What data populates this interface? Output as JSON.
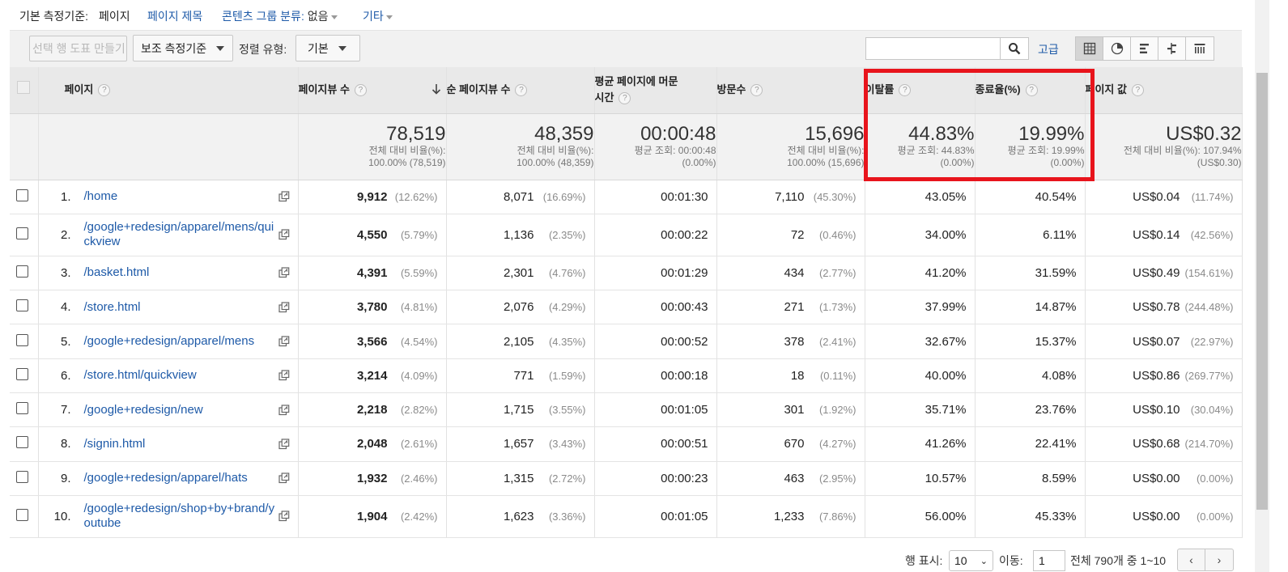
{
  "dimension_bar": {
    "primary_label": "기본 측정기준:",
    "primary_value": "페이지",
    "alt_dimension": "페이지 제목",
    "content_group_label": "콘텐츠 그룹 분류:",
    "content_group_value": "없음",
    "other": "기타"
  },
  "toolbar": {
    "create_chart": "선택 행 도표 만들기",
    "secondary_dimension": "보조 측정기준",
    "sort_type_label": "정렬 유형:",
    "sort_type_value": "기본",
    "search_value": "",
    "advanced": "고급"
  },
  "view_icons": [
    "table-view-icon",
    "pie-view-icon",
    "bar-view-icon",
    "comparison-view-icon",
    "pivot-view-icon"
  ],
  "columns": {
    "page": "페이지",
    "pageviews": "페이지뷰 수",
    "unique_pageviews": "순 페이지뷰 수",
    "avg_time_line1": "평균 페이지에 머문",
    "avg_time_line2": "시간",
    "entrances": "방문수",
    "bounce_rate": "이탈률",
    "exit_rate": "종료율(%)",
    "page_value": "페이지 값"
  },
  "totals": {
    "pageviews": {
      "value": "78,519",
      "sub1": "전체 대비 비율(%):",
      "sub2": "100.00% (78,519)"
    },
    "unique_pageviews": {
      "value": "48,359",
      "sub1": "전체 대비 비율(%):",
      "sub2": "100.00% (48,359)"
    },
    "avg_time": {
      "value": "00:00:48",
      "sub1": "평균 조회: 00:00:48",
      "sub2": "(0.00%)"
    },
    "entrances": {
      "value": "15,696",
      "sub1": "전체 대비 비율(%):",
      "sub2": "100.00% (15,696)"
    },
    "bounce_rate": {
      "value": "44.83%",
      "sub1": "평균 조회: 44.83%",
      "sub2": "(0.00%)"
    },
    "exit_rate": {
      "value": "19.99%",
      "sub1": "평균 조회: 19.99%",
      "sub2": "(0.00%)"
    },
    "page_value": {
      "value": "US$0.32",
      "sub1": "전체 대비 비율(%): 107.94%",
      "sub2": "(US$0.30)"
    }
  },
  "rows": [
    {
      "idx": "1.",
      "page": "/home",
      "pv": "9,912",
      "pv_pct": "(12.62%)",
      "upv": "8,071",
      "upv_pct": "(16.69%)",
      "time": "00:01:30",
      "ent": "7,110",
      "ent_pct": "(45.30%)",
      "bounce": "43.05%",
      "exit": "40.54%",
      "val": "US$0.04",
      "val_pct": "(11.74%)"
    },
    {
      "idx": "2.",
      "page": "/google+redesign/apparel/mens/quickview",
      "pv": "4,550",
      "pv_pct": "(5.79%)",
      "upv": "1,136",
      "upv_pct": "(2.35%)",
      "time": "00:00:22",
      "ent": "72",
      "ent_pct": "(0.46%)",
      "bounce": "34.00%",
      "exit": "6.11%",
      "val": "US$0.14",
      "val_pct": "(42.56%)"
    },
    {
      "idx": "3.",
      "page": "/basket.html",
      "pv": "4,391",
      "pv_pct": "(5.59%)",
      "upv": "2,301",
      "upv_pct": "(4.76%)",
      "time": "00:01:29",
      "ent": "434",
      "ent_pct": "(2.77%)",
      "bounce": "41.20%",
      "exit": "31.59%",
      "val": "US$0.49",
      "val_pct": "(154.61%)"
    },
    {
      "idx": "4.",
      "page": "/store.html",
      "pv": "3,780",
      "pv_pct": "(4.81%)",
      "upv": "2,076",
      "upv_pct": "(4.29%)",
      "time": "00:00:43",
      "ent": "271",
      "ent_pct": "(1.73%)",
      "bounce": "37.99%",
      "exit": "14.87%",
      "val": "US$0.78",
      "val_pct": "(244.48%)"
    },
    {
      "idx": "5.",
      "page": "/google+redesign/apparel/mens",
      "pv": "3,566",
      "pv_pct": "(4.54%)",
      "upv": "2,105",
      "upv_pct": "(4.35%)",
      "time": "00:00:52",
      "ent": "378",
      "ent_pct": "(2.41%)",
      "bounce": "32.67%",
      "exit": "15.37%",
      "val": "US$0.07",
      "val_pct": "(22.97%)"
    },
    {
      "idx": "6.",
      "page": "/store.html/quickview",
      "pv": "3,214",
      "pv_pct": "(4.09%)",
      "upv": "771",
      "upv_pct": "(1.59%)",
      "time": "00:00:18",
      "ent": "18",
      "ent_pct": "(0.11%)",
      "bounce": "40.00%",
      "exit": "4.08%",
      "val": "US$0.86",
      "val_pct": "(269.77%)"
    },
    {
      "idx": "7.",
      "page": "/google+redesign/new",
      "pv": "2,218",
      "pv_pct": "(2.82%)",
      "upv": "1,715",
      "upv_pct": "(3.55%)",
      "time": "00:01:05",
      "ent": "301",
      "ent_pct": "(1.92%)",
      "bounce": "35.71%",
      "exit": "23.76%",
      "val": "US$0.10",
      "val_pct": "(30.04%)"
    },
    {
      "idx": "8.",
      "page": "/signin.html",
      "pv": "2,048",
      "pv_pct": "(2.61%)",
      "upv": "1,657",
      "upv_pct": "(3.43%)",
      "time": "00:00:51",
      "ent": "670",
      "ent_pct": "(4.27%)",
      "bounce": "41.26%",
      "exit": "22.41%",
      "val": "US$0.68",
      "val_pct": "(214.70%)"
    },
    {
      "idx": "9.",
      "page": "/google+redesign/apparel/hats",
      "pv": "1,932",
      "pv_pct": "(2.46%)",
      "upv": "1,315",
      "upv_pct": "(2.72%)",
      "time": "00:00:23",
      "ent": "463",
      "ent_pct": "(2.95%)",
      "bounce": "10.57%",
      "exit": "8.59%",
      "val": "US$0.00",
      "val_pct": "(0.00%)"
    },
    {
      "idx": "10.",
      "page": "/google+redesign/shop+by+brand/youtube",
      "pv": "1,904",
      "pv_pct": "(2.42%)",
      "upv": "1,623",
      "upv_pct": "(3.36%)",
      "time": "00:01:05",
      "ent": "1,233",
      "ent_pct": "(7.86%)",
      "bounce": "56.00%",
      "exit": "45.33%",
      "val": "US$0.00",
      "val_pct": "(0.00%)"
    }
  ],
  "footer": {
    "rows_label": "행 표시:",
    "rows_value": "10",
    "goto_label": "이동:",
    "goto_value": "1",
    "range_text": "전체 790개 중 1~10",
    "prev": "‹",
    "next": "›"
  },
  "colors": {
    "link": "#1e5aa8",
    "highlight": "#e8141c"
  }
}
